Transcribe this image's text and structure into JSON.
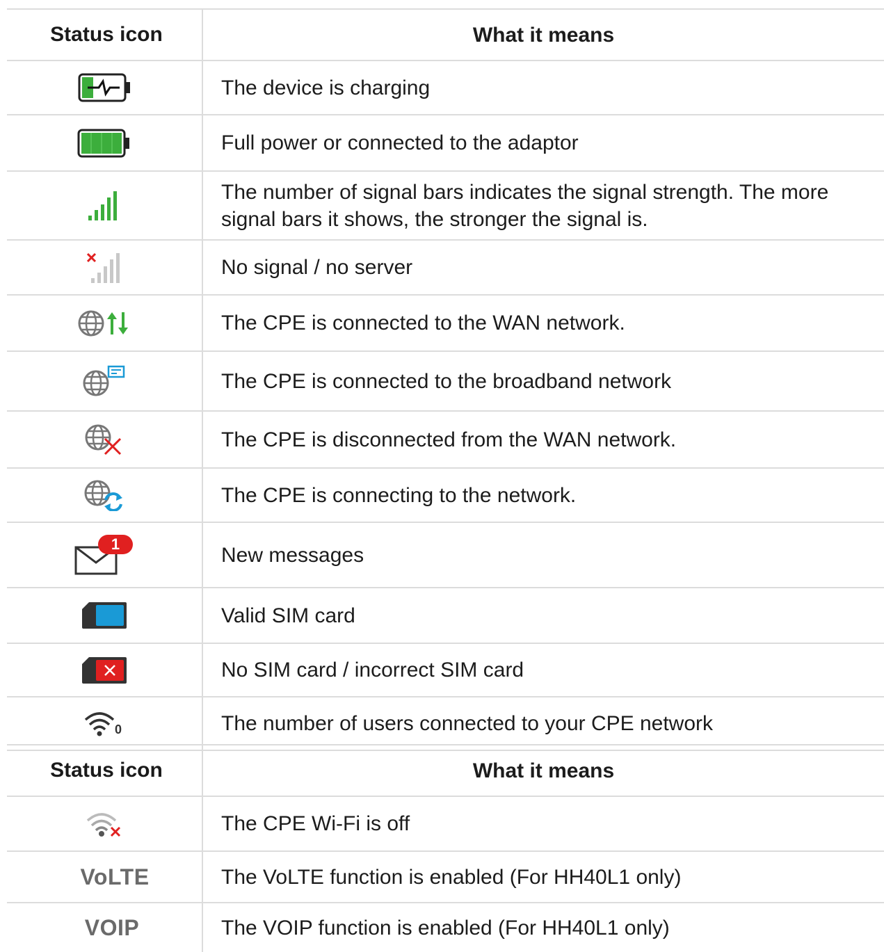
{
  "table1": {
    "header": {
      "col_icon": "Status icon",
      "col_meaning": "What it means"
    },
    "rows": [
      {
        "icon": "battery-charging-icon",
        "meaning": "The device is charging"
      },
      {
        "icon": "battery-full-icon",
        "meaning": "Full power or connected to the adaptor"
      },
      {
        "icon": "signal-bars-icon",
        "meaning": "The number of signal bars indicates the signal strength. The more signal bars it shows, the stronger the signal is."
      },
      {
        "icon": "no-signal-icon",
        "meaning": "No signal / no server"
      },
      {
        "icon": "wan-connected-icon",
        "meaning": "The CPE is connected to the WAN network."
      },
      {
        "icon": "broadband-connected-icon",
        "meaning": "The CPE is connected to the broadband network"
      },
      {
        "icon": "wan-disconnected-icon",
        "meaning": "The CPE is disconnected from the WAN network."
      },
      {
        "icon": "network-connecting-icon",
        "meaning": "The CPE is connecting to the network."
      },
      {
        "icon": "new-message-icon",
        "badge": "1",
        "meaning": "New messages"
      },
      {
        "icon": "sim-valid-icon",
        "meaning": "Valid SIM card"
      },
      {
        "icon": "sim-invalid-icon",
        "meaning": "No SIM card / incorrect SIM card"
      },
      {
        "icon": "wifi-users-icon",
        "user_count": "0",
        "meaning": "The number of users connected to your CPE network"
      }
    ]
  },
  "table2": {
    "header": {
      "col_icon": "Status icon",
      "col_meaning": "What it means"
    },
    "rows": [
      {
        "icon": "wifi-off-icon",
        "meaning": "The CPE Wi-Fi is off"
      },
      {
        "icon_text": "VoLTE",
        "meaning": "The VoLTE function is enabled (For HH40L1 only)"
      },
      {
        "icon_text": "VOIP",
        "meaning": "The VOIP function is enabled (For HH40L1 only)"
      }
    ]
  },
  "colors": {
    "green": "#3cae3c",
    "red": "#e02020",
    "blue": "#1a9ad6",
    "grey_icon": "#7a7a7a",
    "border": "#dcdcdc"
  }
}
